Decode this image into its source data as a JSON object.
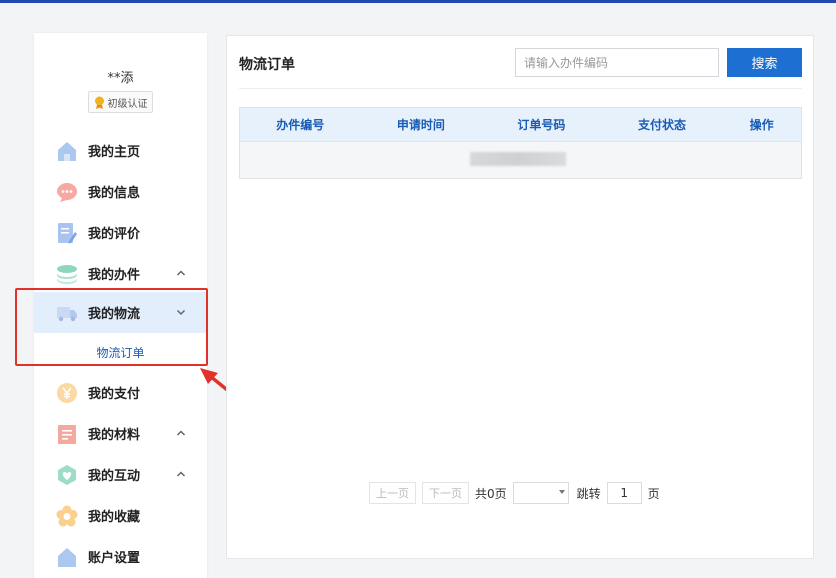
{
  "colors": {
    "accent": "#1e6fd2",
    "nav_active_bg": "#e3eefc",
    "highlight": "#e0312b",
    "topbar": "#1f4bb0"
  },
  "profile": {
    "name": "**添",
    "badge": "初级认证"
  },
  "nav": [
    {
      "label": "我的主页",
      "icon": "home-icon"
    },
    {
      "label": "我的信息",
      "icon": "message-icon"
    },
    {
      "label": "我的评价",
      "icon": "edit-icon"
    },
    {
      "label": "我的办件",
      "icon": "layers-icon"
    },
    {
      "label": "我的物流",
      "icon": "truck-icon"
    },
    {
      "label": "我的支付",
      "icon": "yen-icon"
    },
    {
      "label": "我的材料",
      "icon": "document-icon"
    },
    {
      "label": "我的互动",
      "icon": "heart-icon"
    },
    {
      "label": "我的收藏",
      "icon": "flower-icon"
    },
    {
      "label": "账户设置",
      "icon": "home-icon"
    }
  ],
  "sub_nav": {
    "logistics_order": "物流订单"
  },
  "main": {
    "title": "物流订单",
    "search_placeholder": "请输入办件编码",
    "search_button": "搜索",
    "columns": [
      "办件编号",
      "申请时间",
      "订单号码",
      "支付状态",
      "操作"
    ]
  },
  "pager": {
    "prev": "上一页",
    "next": "下一页",
    "total": "共0页",
    "jump": "跳转",
    "page_value": "1",
    "page_unit": "页"
  }
}
